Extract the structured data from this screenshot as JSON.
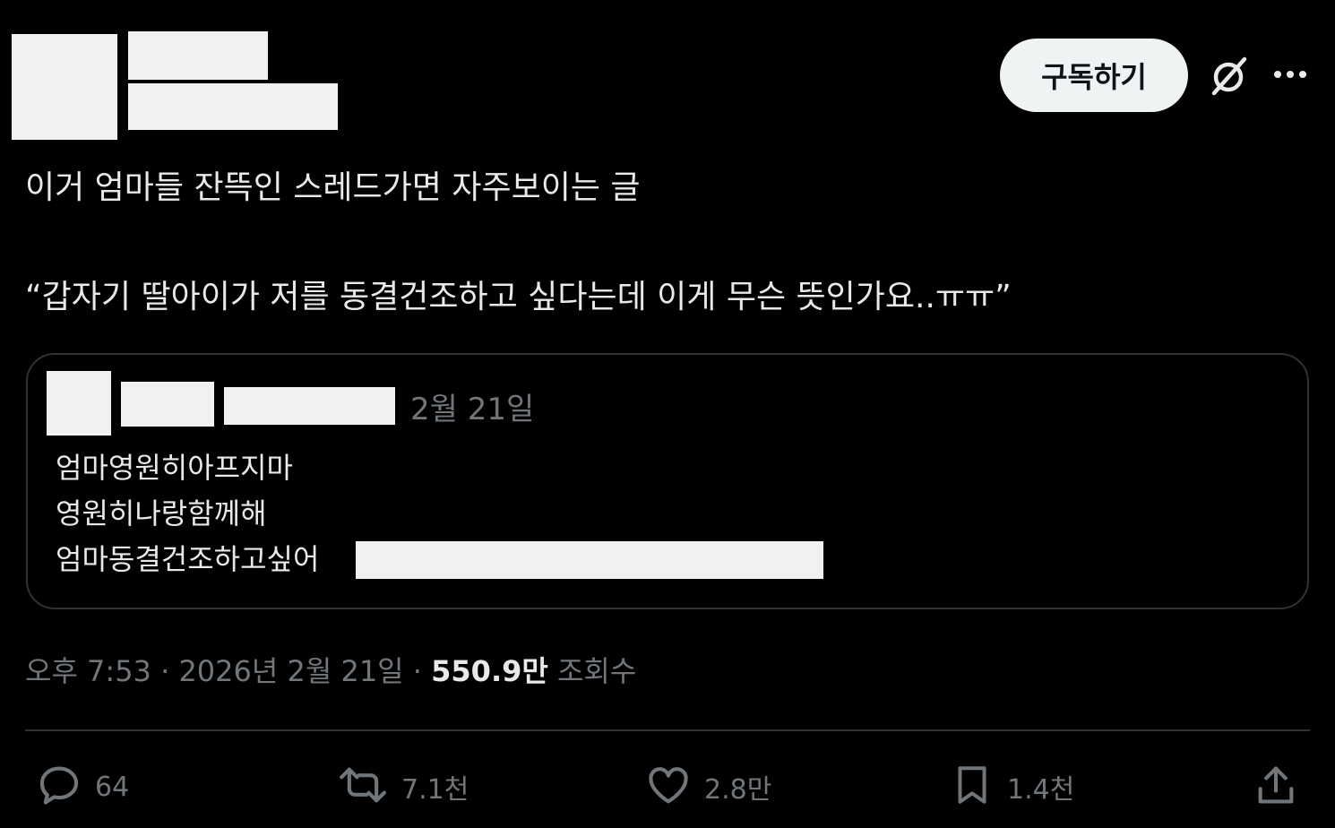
{
  "header": {
    "subscribe_label": "구독하기",
    "icons": [
      "grok-icon",
      "more-icon"
    ]
  },
  "post": {
    "text_line1": "이거 엄마들 잔뜩인 스레드가면 자주보이는 글",
    "text_line2": "“갑자기 딸아이가 저를 동결건조하고 싶다는데 이게 무슨 뜻인가요..ㅠㅠ”"
  },
  "quote": {
    "date": "2월 21일",
    "lines": [
      "엄마영원히아프지마",
      "영원히나랑함께해",
      "엄마동결건조하고싶어"
    ]
  },
  "meta": {
    "time": "오후 7:53",
    "date": "2026년 2월 21일",
    "views_count": "550.9만",
    "views_label": "조회수"
  },
  "actions": {
    "replies": "64",
    "reposts": "7.1천",
    "likes": "2.8만",
    "bookmarks": "1.4천"
  },
  "colors": {
    "background": "#000000",
    "text": "#e7e9ea",
    "muted": "#71767b",
    "border": "#2f3336",
    "subscribe_bg": "#eff3f4"
  }
}
